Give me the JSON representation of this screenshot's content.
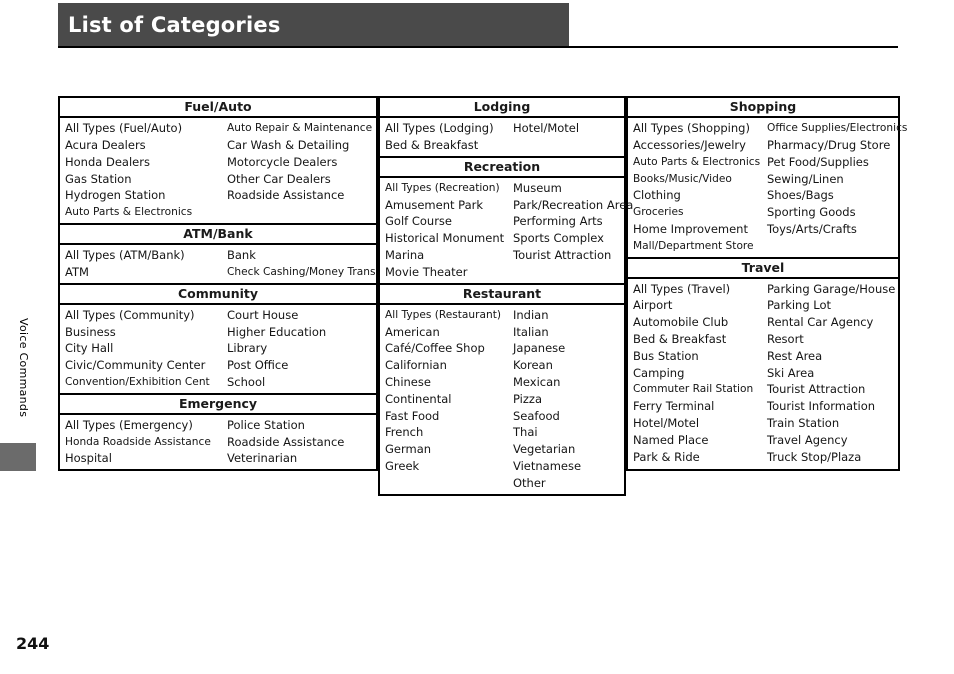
{
  "header": {
    "title": "List of Categories"
  },
  "side": {
    "section_label": "Voice Commands"
  },
  "footer": {
    "page_number": "244"
  },
  "colors": {
    "header_bar": "#4a4a4a",
    "header_text": "#ffffff",
    "rule": "#000000",
    "side_thumb": "#6b6b6b",
    "table_border": "#000000",
    "page_background": "#ffffff"
  },
  "columns": [
    {
      "id": "column-left",
      "groups": [
        {
          "title": "Fuel/Auto",
          "left_items": [
            "All Types (Fuel/Auto)",
            "Acura Dealers",
            "Honda Dealers",
            "Gas Station",
            "Hydrogen Station",
            "Auto Parts & Electronics"
          ],
          "right_items": [
            "Auto Repair & Maintenance",
            "Car Wash & Detailing",
            "Motorcycle Dealers",
            "Other Car Dealers",
            "Roadside Assistance"
          ]
        },
        {
          "title": "ATM/Bank",
          "left_items": [
            "All Types (ATM/Bank)",
            "ATM"
          ],
          "right_items": [
            "Bank",
            "Check Cashing/Money Trans"
          ]
        },
        {
          "title": "Community",
          "left_items": [
            "All Types (Community)",
            "Business",
            "City Hall",
            "Civic/Community Center",
            "Convention/Exhibition Cent"
          ],
          "right_items": [
            "Court House",
            "Higher Education",
            "Library",
            "Post Office",
            "School"
          ]
        },
        {
          "title": "Emergency",
          "left_items": [
            "All Types (Emergency)",
            "Honda Roadside Assistance",
            "Hospital"
          ],
          "right_items": [
            "Police Station",
            "Roadside Assistance",
            "Veterinarian"
          ]
        }
      ]
    },
    {
      "id": "column-middle",
      "groups": [
        {
          "title": "Lodging",
          "left_items": [
            "All Types (Lodging)",
            "Bed & Breakfast"
          ],
          "right_items": [
            "Hotel/Motel"
          ]
        },
        {
          "title": "Recreation",
          "left_items": [
            "All Types (Recreation)",
            "Amusement Park",
            "Golf Course",
            "Historical Monument",
            "Marina",
            "Movie Theater"
          ],
          "right_items": [
            "Museum",
            "Park/Recreation Area",
            "Performing Arts",
            "Sports Complex",
            "Tourist Attraction"
          ]
        },
        {
          "title": "Restaurant",
          "left_items": [
            "All Types (Restaurant)",
            "American",
            "Café/Coffee Shop",
            "Californian",
            "Chinese",
            "Continental",
            "Fast Food",
            "French",
            "German",
            "Greek"
          ],
          "right_items": [
            "Indian",
            "Italian",
            "Japanese",
            "Korean",
            "Mexican",
            "Pizza",
            "Seafood",
            "Thai",
            "Vegetarian",
            "Vietnamese",
            "Other"
          ]
        }
      ]
    },
    {
      "id": "column-right",
      "groups": [
        {
          "title": "Shopping",
          "left_items": [
            "All Types (Shopping)",
            "Accessories/Jewelry",
            "Auto Parts & Electronics",
            "Books/Music/Video",
            "Clothing",
            "Groceries",
            "Home Improvement",
            "Mall/Department Store"
          ],
          "right_items": [
            "Office Supplies/Electronics",
            "Pharmacy/Drug Store",
            "Pet Food/Supplies",
            "Sewing/Linen",
            "Shoes/Bags",
            "Sporting Goods",
            "Toys/Arts/Crafts"
          ]
        },
        {
          "title": "Travel",
          "left_items": [
            "All Types (Travel)",
            "Airport",
            "Automobile Club",
            "Bed & Breakfast",
            "Bus Station",
            "Camping",
            "Commuter Rail Station",
            "Ferry Terminal",
            "Hotel/Motel",
            "Named Place",
            "Park & Ride"
          ],
          "right_items": [
            "Parking Garage/House",
            "Parking Lot",
            "Rental Car Agency",
            "Resort",
            "Rest Area",
            "Ski Area",
            "Tourist Attraction",
            "Tourist Information",
            "Train Station",
            "Travel Agency",
            "Truck Stop/Plaza"
          ]
        }
      ]
    }
  ]
}
